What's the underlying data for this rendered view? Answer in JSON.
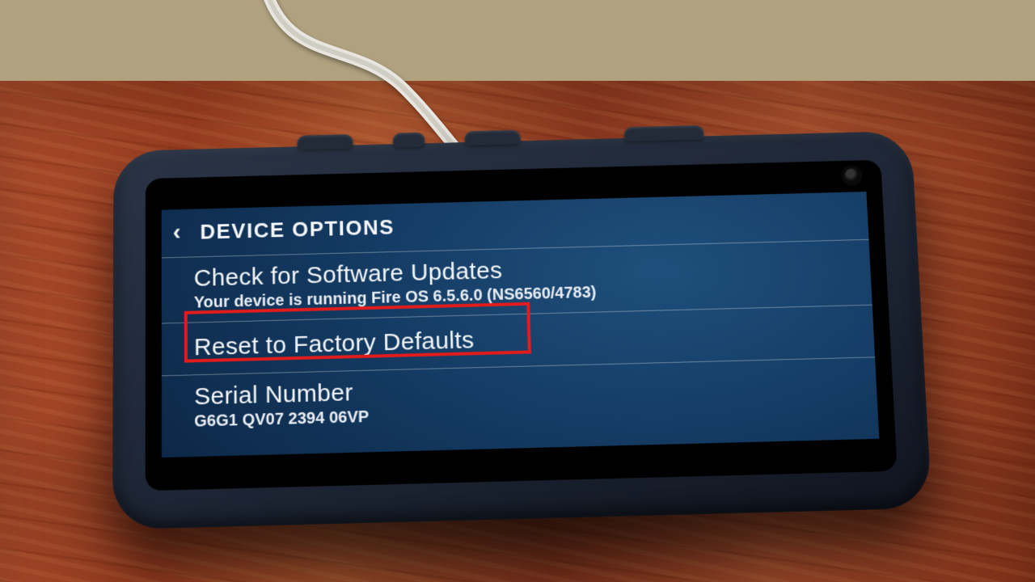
{
  "header": {
    "title": "DEVICE OPTIONS"
  },
  "items": [
    {
      "title": "Check for Software Updates",
      "subtitle": "Your device is running Fire OS 6.5.6.0 (NS6560/4783)"
    },
    {
      "title": "Reset to Factory Defaults"
    },
    {
      "title": "Serial Number",
      "subtitle": "G6G1 QV07 2394 06VP"
    }
  ],
  "highlighted_item_index": 1
}
